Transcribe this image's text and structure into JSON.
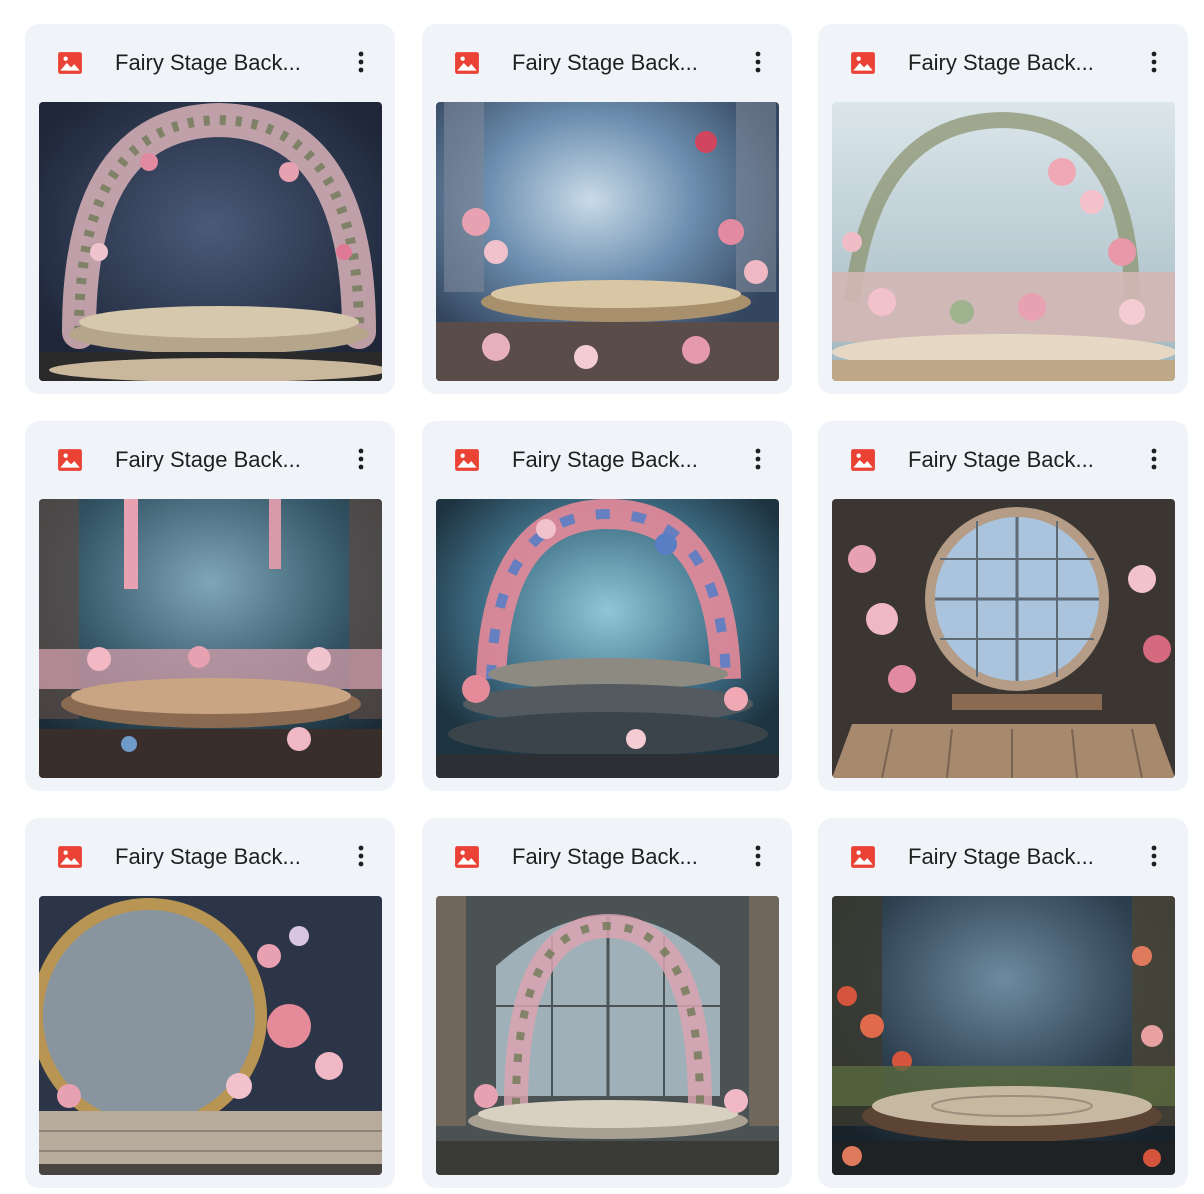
{
  "colors": {
    "card_bg": "#f0f4f9",
    "image_icon_red": "#ea4335",
    "title_text": "#1f1f1f"
  },
  "files": [
    {
      "name": "Fairy Stage Back...",
      "icon": "image-file-icon",
      "thumbnail": "stage with floral arch, dark navy backdrop"
    },
    {
      "name": "Fairy Stage Back...",
      "icon": "image-file-icon",
      "thumbnail": "round stage, pink flowers, pale blue glow"
    },
    {
      "name": "Fairy Stage Back...",
      "icon": "image-file-icon",
      "thumbnail": "wreath arch of pink lilies, light sky"
    },
    {
      "name": "Fairy Stage Back...",
      "icon": "image-file-icon",
      "thumbnail": "wooden round stage, hanging wisteria"
    },
    {
      "name": "Fairy Stage Back...",
      "icon": "image-file-icon",
      "thumbnail": "stepped stage with rose and hydrangea arch"
    },
    {
      "name": "Fairy Stage Back...",
      "icon": "image-file-icon",
      "thumbnail": "round window arch, wooden deck"
    },
    {
      "name": "Fairy Stage Back...",
      "icon": "image-file-icon",
      "thumbnail": "gold round frame with peonies"
    },
    {
      "name": "Fairy Stage Back...",
      "icon": "image-file-icon",
      "thumbnail": "arched windows with floral arch"
    },
    {
      "name": "Fairy Stage Back...",
      "icon": "image-file-icon",
      "thumbnail": "forest clearing stage with poppies"
    }
  ]
}
